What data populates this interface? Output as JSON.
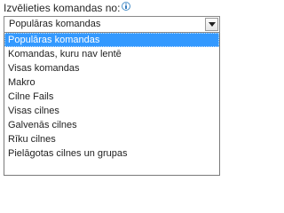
{
  "prompt": {
    "label": "Izvēlieties komandas no:"
  },
  "combo": {
    "value": "Populāras komandas",
    "options": [
      "Populāras komandas",
      "Komandas, kuru nav lentē",
      "Visas komandas",
      "Makro",
      "Cilne Fails",
      "Visas cilnes",
      "Galvenās cilnes",
      "Rīku cilnes",
      "Pielāgotas cilnes un grupas"
    ]
  },
  "colors": {
    "selection": "#3399ff",
    "info_icon": "#3a7fc0"
  },
  "icons": {
    "info": "info-icon",
    "dropdown": "chevron-down-icon"
  }
}
